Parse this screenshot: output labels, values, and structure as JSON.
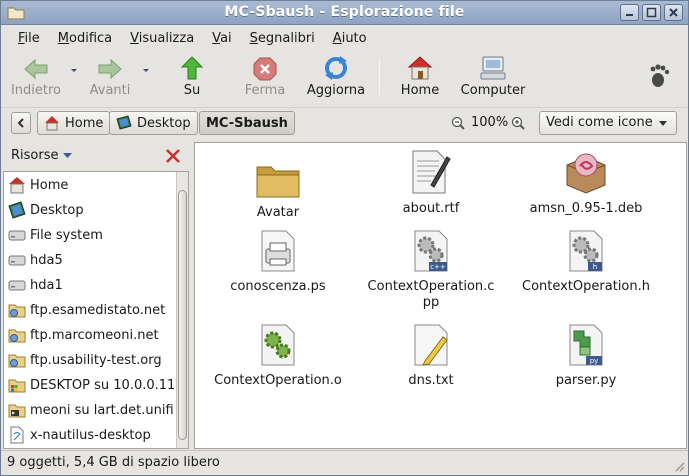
{
  "window": {
    "title": "MC-Sbaush - Esplorazione file"
  },
  "menu": [
    {
      "first": "F",
      "rest": "ile"
    },
    {
      "first": "M",
      "rest": "odifica"
    },
    {
      "first": "V",
      "rest": "isualizza"
    },
    {
      "first": "V",
      "rest": "ai"
    },
    {
      "first": "S",
      "rest": "egnalibri"
    },
    {
      "first": "A",
      "rest": "iuto"
    }
  ],
  "toolbar": {
    "back": "Indietro",
    "forward": "Avanti",
    "up": "Su",
    "stop": "Ferma",
    "reload": "Aggiorna",
    "home": "Home",
    "computer": "Computer"
  },
  "location": {
    "crumbs": [
      "Home",
      "Desktop",
      "MC-Sbaush"
    ],
    "zoom": "100%",
    "view_mode": "Vedi come icone"
  },
  "sidebar": {
    "title": "Risorse",
    "items": [
      {
        "label": "Home",
        "icon": "home-icon"
      },
      {
        "label": "Desktop",
        "icon": "desktop-icon"
      },
      {
        "label": "File system",
        "icon": "drive-icon"
      },
      {
        "label": "hda5",
        "icon": "drive-icon"
      },
      {
        "label": "hda1",
        "icon": "drive-icon"
      },
      {
        "label": "ftp.esamedistato.net",
        "icon": "network-folder-icon"
      },
      {
        "label": "ftp.marcomeoni.net",
        "icon": "network-folder-icon"
      },
      {
        "label": "ftp.usability-test.org",
        "icon": "network-folder-icon"
      },
      {
        "label": "DESKTOP su 10.0.0.11",
        "icon": "windows-share-icon"
      },
      {
        "label": "meoni su lart.det.unifi",
        "icon": "ssh-folder-icon"
      },
      {
        "label": "x-nautilus-desktop",
        "icon": "document-icon"
      }
    ]
  },
  "files": [
    {
      "name": "Avatar",
      "icon": "folder-icon"
    },
    {
      "name": "about.rtf",
      "icon": "rtf-document-icon"
    },
    {
      "name": "amsn_0.95-1.deb",
      "icon": "deb-package-icon"
    },
    {
      "name": "conoscenza.ps",
      "icon": "postscript-printer-icon"
    },
    {
      "name": "ContextOperation.cpp",
      "icon": "cpp-source-icon",
      "badge": "c++"
    },
    {
      "name": "ContextOperation.h",
      "icon": "header-source-icon",
      "badge": "h"
    },
    {
      "name": "ContextOperation.o",
      "icon": "object-file-icon"
    },
    {
      "name": "dns.txt",
      "icon": "text-file-icon"
    },
    {
      "name": "parser.py",
      "icon": "python-file-icon",
      "badge": "py"
    }
  ],
  "status": "9 oggetti, 5,4 GB di spazio libero",
  "colors": {
    "titlebar": "#9aaecb",
    "home_roof": "#c9302c",
    "up_arrow": "#3fae2f",
    "stop": "#cc3333",
    "folder": "#d9b45a"
  }
}
